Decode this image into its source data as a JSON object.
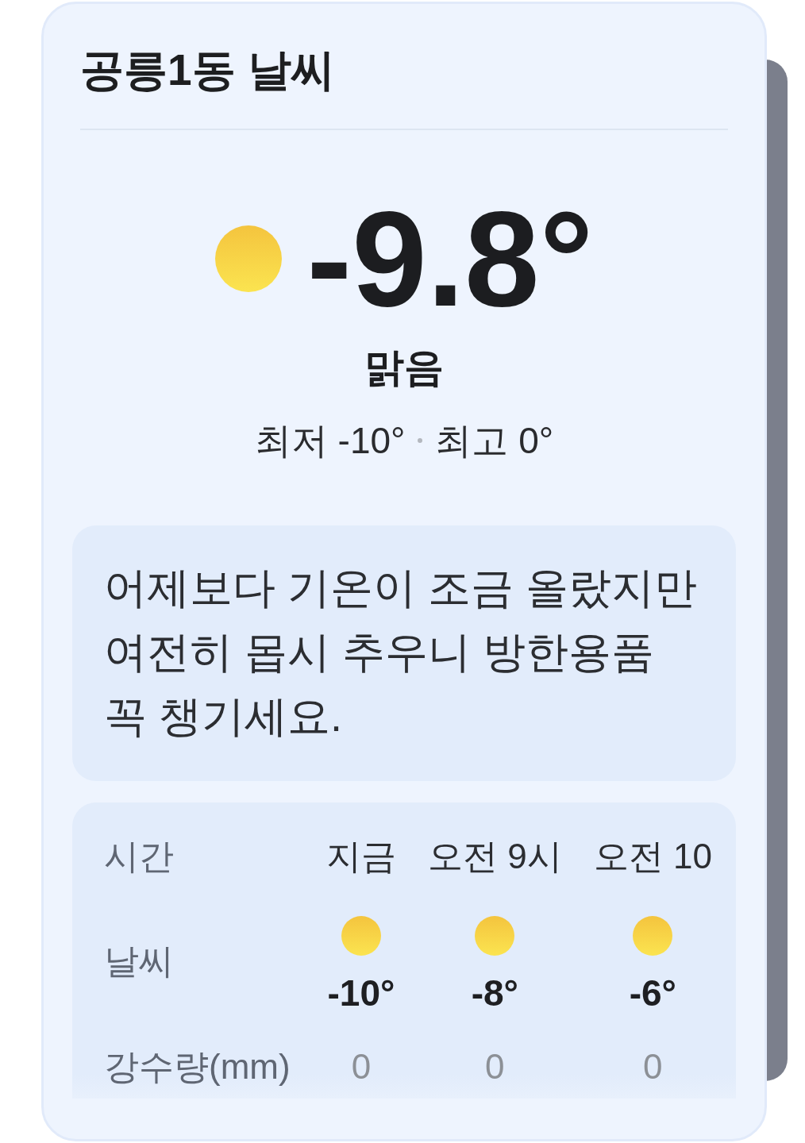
{
  "title": "공릉1동 날씨",
  "current": {
    "kind": "sunny",
    "temperature": "-9.8°",
    "condition": "맑음",
    "low": "최저 -10°",
    "high": "최고 0°"
  },
  "message": {
    "lines": [
      "어제보다 기온이 조금 올랐지만",
      "여전히 몹시 추우니 방한용품",
      "꼭 챙기세요."
    ]
  },
  "hourly": {
    "row_labels": [
      "시간",
      "날씨",
      "강수량(mm)"
    ],
    "hours": [
      {
        "time": "지금",
        "kind": "sunny",
        "temperature": "-10°",
        "precipitation": "0"
      },
      {
        "time": "오전 9시",
        "kind": "sunny",
        "temperature": "-8°",
        "precipitation": "0"
      },
      {
        "time": "오전 10",
        "kind": "sunny",
        "temperature": "-6°",
        "precipitation": "0"
      }
    ]
  }
}
